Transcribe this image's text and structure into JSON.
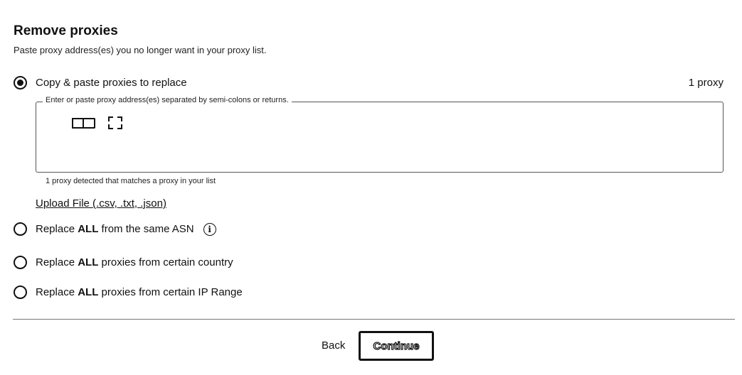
{
  "header": {
    "title": "Remove proxies",
    "subtitle": "Paste proxy address(es) you no longer want in your proxy list."
  },
  "options": {
    "copy_paste": {
      "label": "Copy & paste proxies to replace",
      "selected": true,
      "count": "1 proxy"
    },
    "same_asn": {
      "prefix": "Replace ",
      "bold": "ALL",
      "suffix": " from the same ASN",
      "selected": false,
      "info_icon": "i"
    },
    "country": {
      "prefix": "Replace ",
      "bold": "ALL",
      "suffix": " proxies from certain country",
      "selected": false
    },
    "ip_range": {
      "prefix": "Replace ",
      "bold": "ALL",
      "suffix": " proxies from certain IP Range",
      "selected": false
    }
  },
  "textarea": {
    "legend": "Enter or paste proxy address(es) separated by semi-colons or returns.",
    "helper": "1 proxy detected that matches a proxy in your list"
  },
  "upload": {
    "label": "Upload File (.csv, .txt, .json)"
  },
  "footer": {
    "back_label": "Back",
    "continue_label": "Continue"
  }
}
